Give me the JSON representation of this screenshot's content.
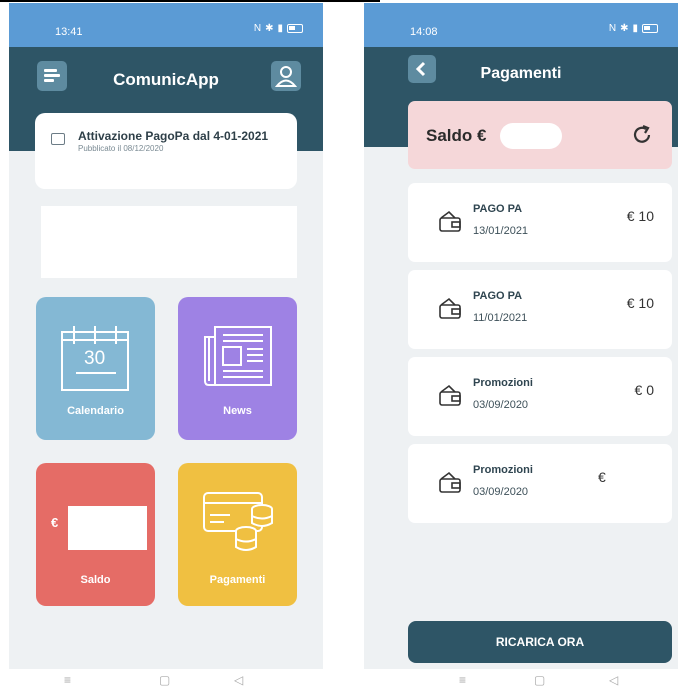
{
  "left_screen": {
    "status_time": "13:41",
    "app_title": "ComunicApp",
    "news": {
      "title": "Attivazione PagoPa dal 4-01-2021",
      "published": "Pubblicato il 08/12/2020"
    },
    "tiles": {
      "calendar_day": "30",
      "calendar_label": "Calendario",
      "news_label": "News",
      "saldo_currency": "€",
      "saldo_label": "Saldo",
      "pay_label": "Pagamenti"
    }
  },
  "right_screen": {
    "status_time": "14:08",
    "title": "Pagamenti",
    "saldo_label": "Saldo €",
    "transactions": [
      {
        "title": "PAGO PA",
        "date": "13/01/2021",
        "amount": "€ 10"
      },
      {
        "title": "PAGO PA",
        "date": "11/01/2021",
        "amount": "€ 10"
      },
      {
        "title": "Promozioni",
        "date": "03/09/2020",
        "amount": "€ 0"
      },
      {
        "title": "Promozioni",
        "date": "03/09/2020",
        "amount": "€"
      }
    ],
    "ricarica_label": "RICARICA ORA"
  },
  "colors": {
    "header": "#2e5566",
    "statusbar": "#5b9bd5",
    "calendar_tile": "#84b8d4",
    "news_tile": "#9e82e4",
    "saldo_tile": "#e56c66",
    "pay_tile": "#f0c041",
    "saldo_card": "#f5d7d9"
  },
  "icons": [
    "hamburger-menu-icon",
    "user-icon",
    "news-icon",
    "calendar-icon",
    "newspaper-icon",
    "payments-icon",
    "back-icon",
    "refresh-icon",
    "wallet-icon"
  ]
}
